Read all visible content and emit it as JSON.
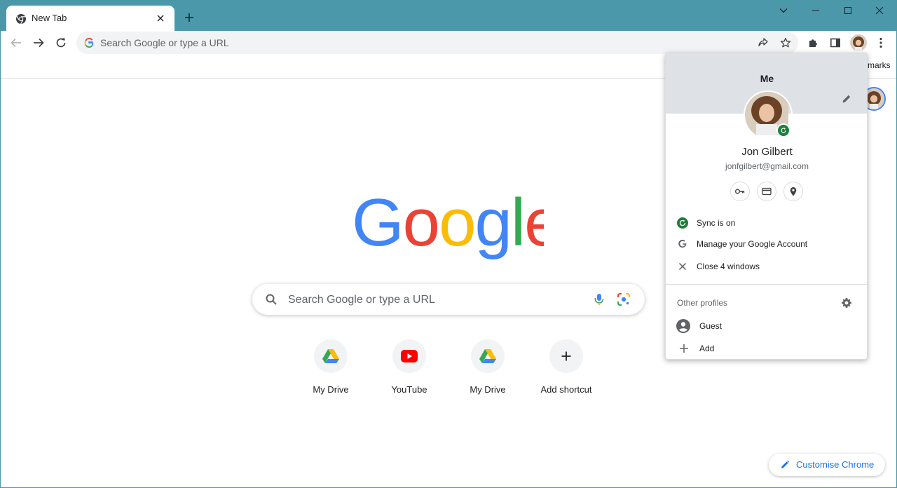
{
  "tab": {
    "title": "New Tab"
  },
  "omnibox": {
    "placeholder": "Search Google or type a URL"
  },
  "bookmarks": {
    "partial_text": "marks"
  },
  "search": {
    "placeholder": "Search Google or type a URL"
  },
  "shortcuts": [
    {
      "label": "My Drive",
      "icon": "google-drive-icon"
    },
    {
      "label": "YouTube",
      "icon": "youtube-icon"
    },
    {
      "label": "My Drive",
      "icon": "google-drive-icon"
    },
    {
      "label": "Add shortcut",
      "icon": "plus-icon"
    }
  ],
  "customise": {
    "label": "Customise Chrome"
  },
  "profile_menu": {
    "header_title": "Me",
    "name": "Jon Gilbert",
    "email": "jonfgilbert@gmail.com",
    "quick_actions": [
      "key-icon",
      "credit-card-icon",
      "location-pin-icon"
    ],
    "items": [
      {
        "label": "Sync is on",
        "icon": "sync-icon"
      },
      {
        "label": "Manage your Google Account",
        "icon": "google-g-icon"
      },
      {
        "label": "Close 4 windows",
        "icon": "close-icon"
      }
    ],
    "other_profiles_label": "Other profiles",
    "profiles": [
      {
        "label": "Guest",
        "icon": "person-icon"
      },
      {
        "label": "Add",
        "icon": "plus-icon"
      }
    ]
  },
  "colors": {
    "titlebar": "#4a98aa",
    "accent_blue": "#1a73e8",
    "sync_green": "#188038"
  }
}
